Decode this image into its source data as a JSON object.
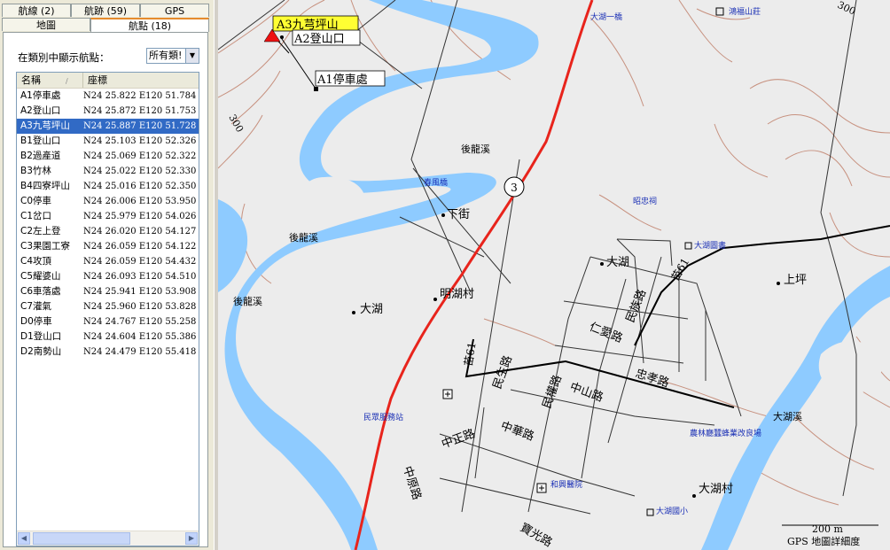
{
  "tabs_row1": [
    {
      "label": "航線 (2)"
    },
    {
      "label": "航跡 (59)"
    },
    {
      "label": "GPS"
    }
  ],
  "tabs_row2": [
    {
      "label": "地圖"
    },
    {
      "label": "航點 (18)"
    }
  ],
  "category_label": "在類別中顯示航點：",
  "category_select": "所有類!",
  "list": {
    "col_name": "名稱",
    "col_coord": "座標",
    "rows": [
      {
        "name": "A1停車處",
        "coord": "N24 25.822 E120 51.784"
      },
      {
        "name": "A2登山口",
        "coord": "N24 25.872 E120 51.753"
      },
      {
        "name": "A3九芎坪山",
        "coord": "N24 25.887 E120 51.728",
        "selected": true
      },
      {
        "name": "B1登山口",
        "coord": "N24 25.103 E120 52.326"
      },
      {
        "name": "B2過產道",
        "coord": "N24 25.069 E120 52.322"
      },
      {
        "name": "B3竹林",
        "coord": "N24 25.022 E120 52.330"
      },
      {
        "name": "B4四寮坪山",
        "coord": "N24 25.016 E120 52.350"
      },
      {
        "name": "C0停車",
        "coord": "N24 26.006 E120 53.950"
      },
      {
        "name": "C1岔口",
        "coord": "N24 25.979 E120 54.026"
      },
      {
        "name": "C2左上登",
        "coord": "N24 26.020 E120 54.127"
      },
      {
        "name": "C3果園工寮",
        "coord": "N24 26.059 E120 54.122"
      },
      {
        "name": "C4攻頂",
        "coord": "N24 26.059 E120 54.432"
      },
      {
        "name": "C5耀婆山",
        "coord": "N24 26.093 E120 54.510"
      },
      {
        "name": "C6車落處",
        "coord": "N24 25.941 E120 53.908"
      },
      {
        "name": "C7灌氣",
        "coord": "N24 25.960 E120 53.828"
      },
      {
        "name": "D0停車",
        "coord": "N24 24.767 E120 55.258"
      },
      {
        "name": "D1登山口",
        "coord": "N24 24.604 E120 55.386"
      },
      {
        "name": "D2南勢山",
        "coord": "N24 24.479 E120 55.418"
      }
    ]
  },
  "map": {
    "waypoints": {
      "a3": "A3九芎坪山",
      "a2": "A2登山口",
      "a1": "A1停車處"
    },
    "places": {
      "hou_long_xi_1": "後龍溪",
      "hou_long_xi_2": "後龍溪",
      "hou_long_xi_3": "後龍溪",
      "xia_jie": "下街",
      "dahu": "大湖",
      "ming_hu_cun": "明湖村",
      "dahu_2": "大湖",
      "shang_ping": "上坪",
      "dahu_xi": "大湖溪",
      "dahu_cun": "大湖村"
    },
    "streets": {
      "minzu": "民族路",
      "renai": "仁愛路",
      "zhongxiao": "忠孝路",
      "minsheng": "民生路",
      "minquan": "民權路",
      "zhongshan": "中山路",
      "zhonghua": "中華路",
      "zhongzheng": "中正路",
      "zhongyuan": "中原路",
      "miao61_a": "苗61",
      "miao61_b": "苗61",
      "guangfu": "寶光路"
    },
    "pois": {
      "dahu_bridge": "大湖一橋",
      "hongfu": "鴻福山莊",
      "chunfeng": "春風橋",
      "zhaozhong": "昭忠祠",
      "library": "大湖圖書",
      "minzhong": "民眾服務站",
      "agri": "農林廳蠶蜂業改良場",
      "hospital": "和興醫院",
      "school": "大湖國小"
    },
    "route_number": "3",
    "contour_300a": "300",
    "contour_300b": "300",
    "scale_label": "200 m",
    "detail_label": "GPS 地圖詳細度"
  },
  "colors": {
    "river": "#8ecbff",
    "road_red": "#e8241c",
    "selected_row": "#316ac5",
    "waypoint_label_bg": "#ffff33"
  }
}
